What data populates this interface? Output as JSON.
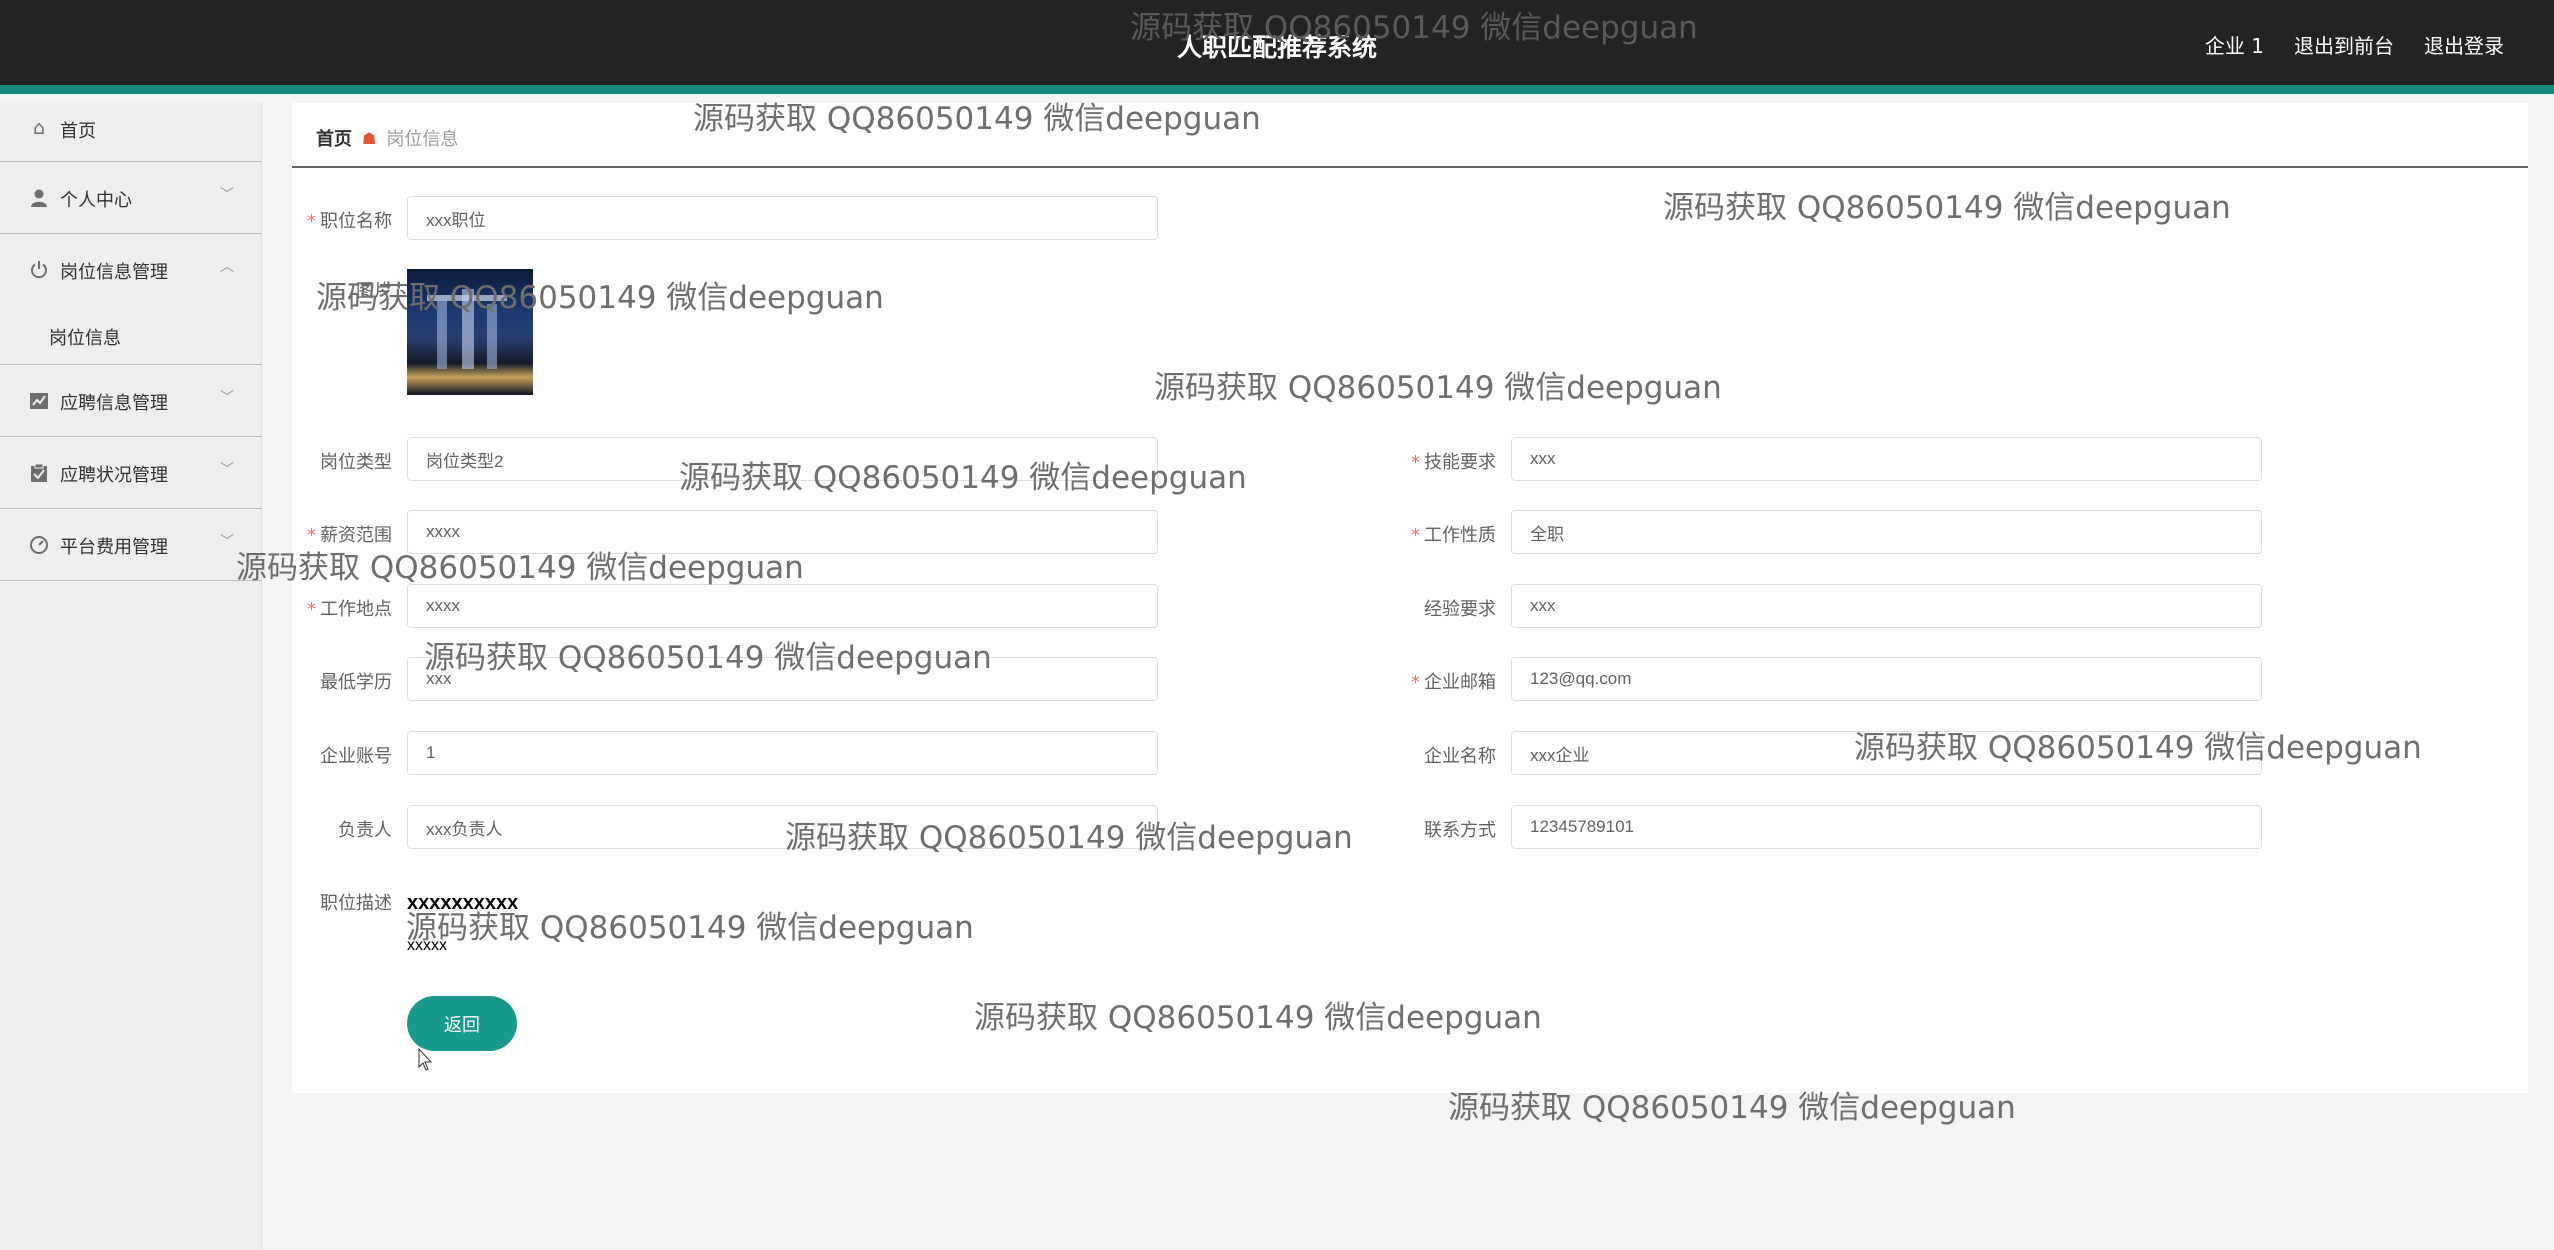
{
  "header": {
    "title": "人职匹配推荐系统",
    "links": [
      "企业 1",
      "退出到前台",
      "退出登录"
    ]
  },
  "sidebar": {
    "items": [
      {
        "label": "首页",
        "icon": "home-icon"
      },
      {
        "label": "个人中心",
        "icon": "user-icon"
      },
      {
        "label": "岗位信息管理",
        "icon": "power-icon",
        "expanded": true
      },
      {
        "label": "岗位信息",
        "sub": true
      },
      {
        "label": "应聘信息管理",
        "icon": "chart-icon"
      },
      {
        "label": "应聘状况管理",
        "icon": "clipboard-icon"
      },
      {
        "label": "平台费用管理",
        "icon": "gauge-icon"
      }
    ]
  },
  "breadcrumb": {
    "home": "首页",
    "current": "岗位信息"
  },
  "form": {
    "position_name": {
      "label": "职位名称",
      "value": "xxx职位",
      "required": true
    },
    "image_label": "图片",
    "job_type": {
      "label": "岗位类型",
      "value": "岗位类型2"
    },
    "skill_req": {
      "label": "技能要求",
      "value": "xxx",
      "required": true
    },
    "salary": {
      "label": "薪资范围",
      "value": "xxxx",
      "required": true
    },
    "work_nature": {
      "label": "工作性质",
      "value": "全职",
      "required": true
    },
    "location": {
      "label": "工作地点",
      "value": "xxxx",
      "required": true
    },
    "experience": {
      "label": "经验要求",
      "value": "xxx"
    },
    "education": {
      "label": "最低学历",
      "value": "xxx"
    },
    "email": {
      "label": "企业邮箱",
      "value": "123@qq.com",
      "required": true
    },
    "account": {
      "label": "企业账号",
      "value": "1"
    },
    "company": {
      "label": "企业名称",
      "value": "xxx企业"
    },
    "manager": {
      "label": "负责人",
      "value": "xxx负责人"
    },
    "contact": {
      "label": "联系方式",
      "value": "12345789101"
    },
    "description": {
      "label": "职位描述",
      "line1": "xxxxxxxxxx",
      "line2": "xxxxx"
    },
    "back_button": "返回"
  },
  "watermark": "源码获取 QQ86050149 微信deepguan",
  "colors": {
    "header_bg": "#222324",
    "accent": "#18998b",
    "required": "#f56c6c"
  }
}
